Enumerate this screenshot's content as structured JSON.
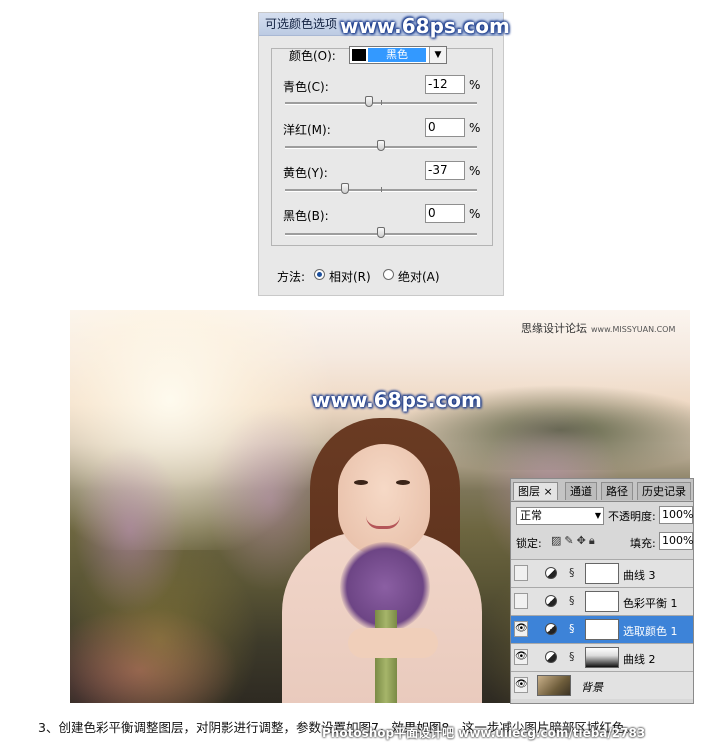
{
  "dialog": {
    "title": "可选颜色选项",
    "colors_label": "颜色(O):",
    "colors_value": "黑色",
    "channels": [
      {
        "label": "青色(C):",
        "value": "-12",
        "unit": "%",
        "slider": -0.12
      },
      {
        "label": "洋红(M):",
        "value": "0",
        "unit": "%",
        "slider": 0
      },
      {
        "label": "黄色(Y):",
        "value": "-37",
        "unit": "%",
        "slider": -0.37
      },
      {
        "label": "黑色(B):",
        "value": "0",
        "unit": "%",
        "slider": 0
      }
    ],
    "method_label": "方法:",
    "relative_label": "相对(R)",
    "absolute_label": "绝对(A)",
    "selected_method": "relative"
  },
  "watermark": "www.68ps.com",
  "credit": {
    "text": "思缘设计论坛",
    "url_text": "www.MISSYUAN.COM"
  },
  "layers_panel": {
    "tabs": [
      "图层",
      "通道",
      "路径",
      "历史记录"
    ],
    "tab_close": "×",
    "blend_mode": "正常",
    "opacity_label": "不透明度:",
    "opacity_value": "100%",
    "lock_label": "锁定:",
    "fill_label": "填充:",
    "fill_value": "100%",
    "layers": [
      {
        "name": "曲线 3",
        "visible": false,
        "selected": false
      },
      {
        "name": "色彩平衡 1",
        "visible": false,
        "selected": false
      },
      {
        "name": "选取颜色 1",
        "visible": true,
        "selected": true
      },
      {
        "name": "曲线 2",
        "visible": true,
        "selected": false
      },
      {
        "name": "背景",
        "visible": true,
        "selected": false
      }
    ]
  },
  "caption": "3、创建色彩平衡调整图层，对阴影进行调整，参数设置如图7，效果如图8。这一步减少图片暗部区域红色。",
  "caption_watermark": "Photoshop平面设计吧 www.uiiecg.com/tieba/2783"
}
